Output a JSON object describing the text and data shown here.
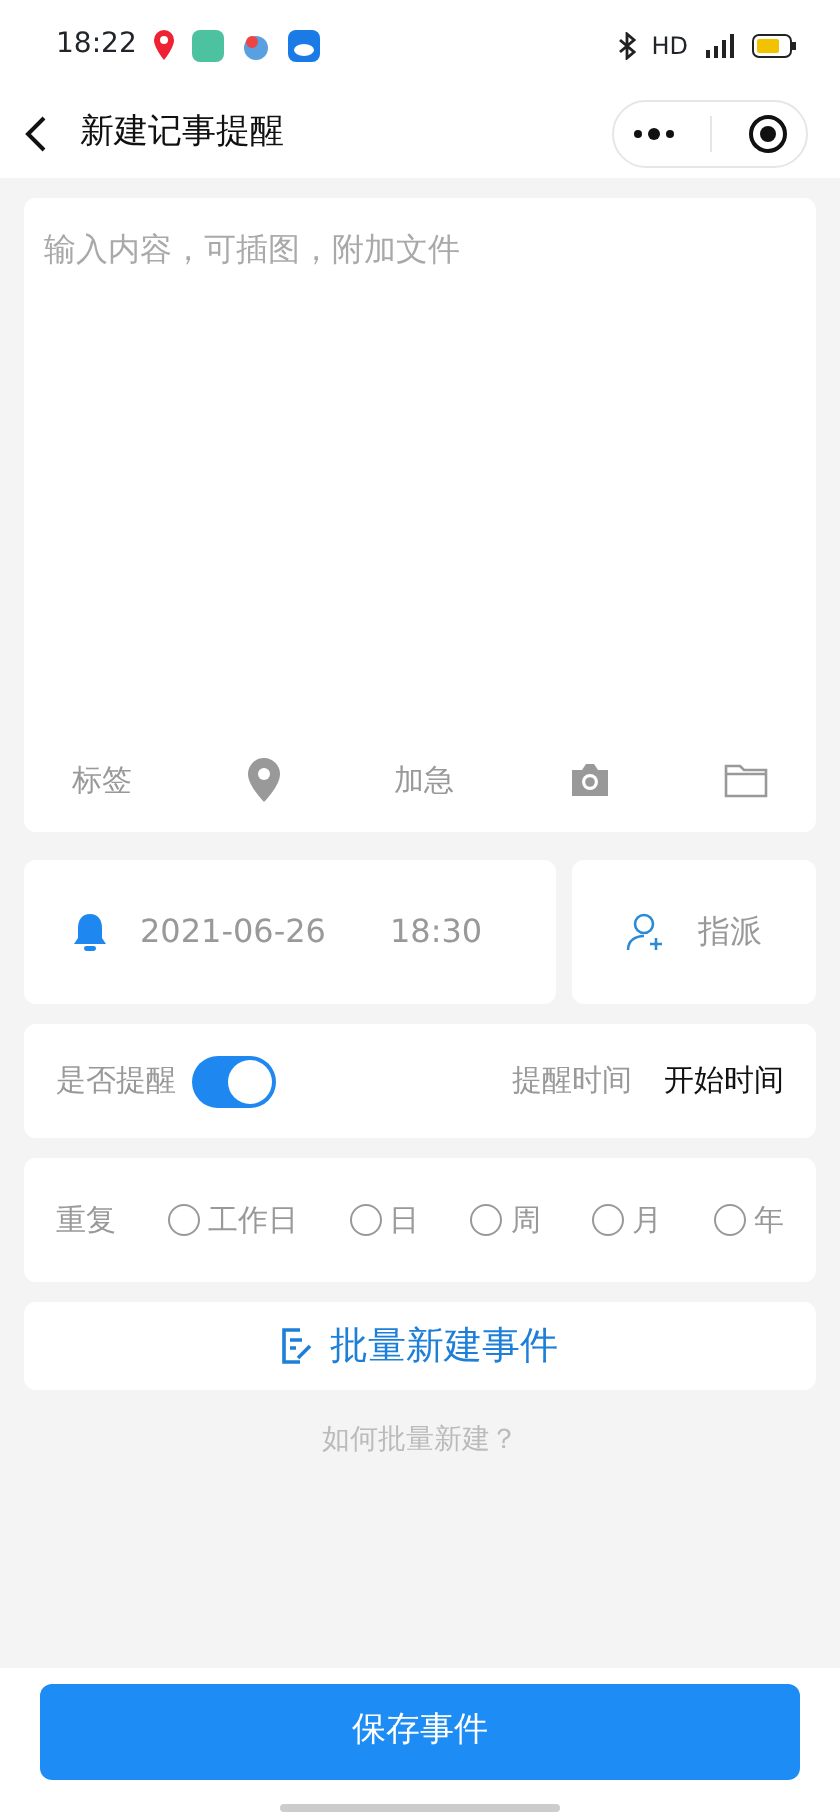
{
  "status_bar": {
    "time": "18:22",
    "network": "HD"
  },
  "nav": {
    "title": "新建记事提醒"
  },
  "note": {
    "placeholder": "输入内容，可插图，附加文件",
    "tools": [
      {
        "kind": "text",
        "label": "标签"
      },
      {
        "kind": "location"
      },
      {
        "kind": "text",
        "label": "加急"
      },
      {
        "kind": "camera"
      },
      {
        "kind": "folder"
      }
    ]
  },
  "schedule": {
    "date": "2021-06-26",
    "time": "18:30",
    "assign": "指派"
  },
  "reminder": {
    "label": "是否提醒",
    "on": true,
    "time_label": "提醒时间",
    "time_value": "开始时间"
  },
  "repeat": {
    "label": "重复",
    "options": [
      {
        "label": "工作日",
        "selected": false
      },
      {
        "label": "日",
        "selected": false
      },
      {
        "label": "周",
        "selected": false
      },
      {
        "label": "月",
        "selected": false
      },
      {
        "label": "年",
        "selected": false
      }
    ]
  },
  "batch": {
    "button": "批量新建事件",
    "help": "如何批量新建？"
  },
  "save_button": "保存事件"
}
